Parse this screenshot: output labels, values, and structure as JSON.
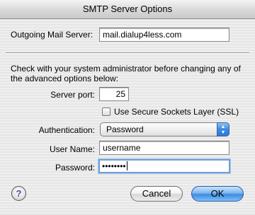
{
  "window": {
    "title": "SMTP Server Options"
  },
  "outgoing": {
    "label": "Outgoing Mail Server:",
    "value": "mail.dialup4less.com"
  },
  "notice": {
    "line1": "Check with your system administrator before changing any of",
    "line2": "the advanced options below:"
  },
  "port": {
    "label": "Server port:",
    "value": "25"
  },
  "ssl": {
    "label": "Use Secure Sockets Layer (SSL)",
    "checked": false
  },
  "auth": {
    "label": "Authentication:",
    "value": "Password"
  },
  "username": {
    "label": "User Name:",
    "value": "username"
  },
  "password": {
    "label": "Password:",
    "value": "••••••••"
  },
  "buttons": {
    "help": "?",
    "cancel": "Cancel",
    "ok": "OK"
  },
  "colors": {
    "accent": "#3d8ce0",
    "focus_ring": "#6f9fd8"
  }
}
